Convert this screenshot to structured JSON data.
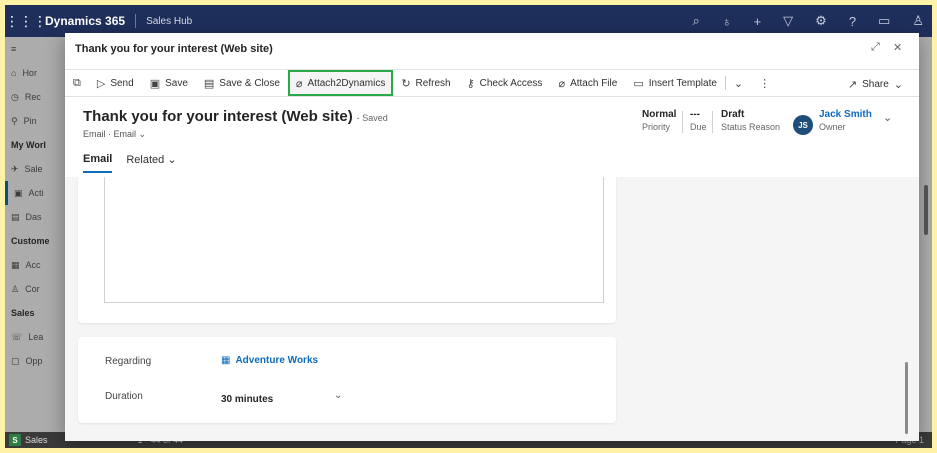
{
  "app": {
    "waffle": "⋮⋮⋮",
    "name": "Dynamics 365",
    "area": "Sales Hub"
  },
  "topbar_icons": [
    "search-icon",
    "lightbulb-icon",
    "plus-icon",
    "filter-icon",
    "gear-icon",
    "help-icon",
    "chat-icon",
    "person-icon"
  ],
  "sidenav": {
    "items": [
      {
        "icon": "≡",
        "label": ""
      },
      {
        "icon": "⌂",
        "label": "Hor"
      },
      {
        "icon": "◷",
        "label": "Rec"
      },
      {
        "icon": "⚲",
        "label": "Pin"
      }
    ],
    "group1": "My Worl",
    "items2": [
      {
        "icon": "✈",
        "label": "Sale"
      },
      {
        "icon": "▣",
        "label": "Acti"
      },
      {
        "icon": "▤",
        "label": "Das"
      }
    ],
    "group2": "Custome",
    "items3": [
      {
        "icon": "▦",
        "label": "Acc"
      },
      {
        "icon": "♙",
        "label": "Cor"
      }
    ],
    "group3": "Sales",
    "items4": [
      {
        "icon": "☏",
        "label": "Lea"
      },
      {
        "icon": "▢",
        "label": "Opp"
      }
    ]
  },
  "statusbar": {
    "env_letter": "S",
    "env_name": "Sales",
    "count": "1 - 44 of 44",
    "pager": "Page 1"
  },
  "dialog": {
    "title": "Thank you for your interest (Web site)",
    "commands": {
      "send": "Send",
      "save": "Save",
      "save_close": "Save & Close",
      "attach2dynamics": "Attach2Dynamics",
      "refresh": "Refresh",
      "check_access": "Check Access",
      "attach_file": "Attach File",
      "insert_template": "Insert Template",
      "share": "Share"
    },
    "record": {
      "title": "Thank you for your interest (Web site)",
      "saved": "- Saved",
      "entity": "Email",
      "form": "Email"
    },
    "header": {
      "priority_value": "Normal",
      "priority_label": "Priority",
      "due_value": "---",
      "due_label": "Due",
      "status_value": "Draft",
      "status_label": "Status Reason",
      "owner_initials": "JS",
      "owner_name": "Jack Smith",
      "owner_label": "Owner"
    },
    "tabs": [
      "Email",
      "Related"
    ],
    "fields": {
      "regarding_label": "Regarding",
      "regarding_value": "Adventure Works",
      "duration_label": "Duration",
      "duration_value": "30 minutes"
    }
  },
  "colors": {
    "accent": "#0f6cbd",
    "highlight_border": "#2aa84a",
    "topbar": "#1f2f5c"
  }
}
